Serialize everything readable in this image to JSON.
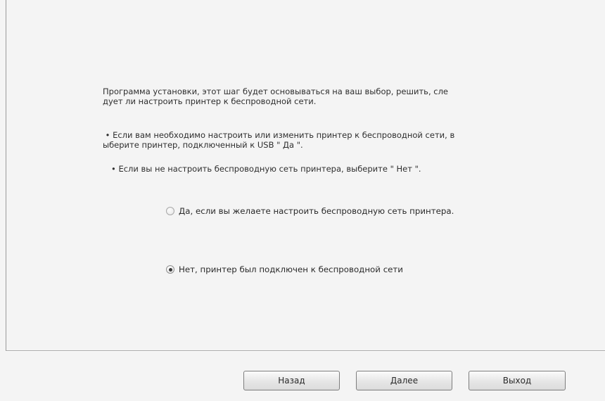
{
  "dialog": {
    "intro_text": "Программа установки, этот шаг будет основываться на ваш выбор, решить, сле\nдует ли настроить принтер к беспроводной сети.",
    "bullet1_text": " • Если вам необходимо настроить или изменить принтер к беспроводной сети, в\nыберите принтер, подключенный к USB \" Да \".",
    "bullet2_text": "• Если вы не настроить беспроводную сеть принтера, выберите \" Нет \".",
    "options": [
      {
        "label": "Да, если вы желаете настроить беспроводную сеть принтера.",
        "selected": false
      },
      {
        "label": "Нет, принтер был подключен к беспроводной сети",
        "selected": true
      }
    ]
  },
  "buttons": {
    "back_label": "Назад",
    "next_label": "Далее",
    "exit_label": "Выход"
  }
}
